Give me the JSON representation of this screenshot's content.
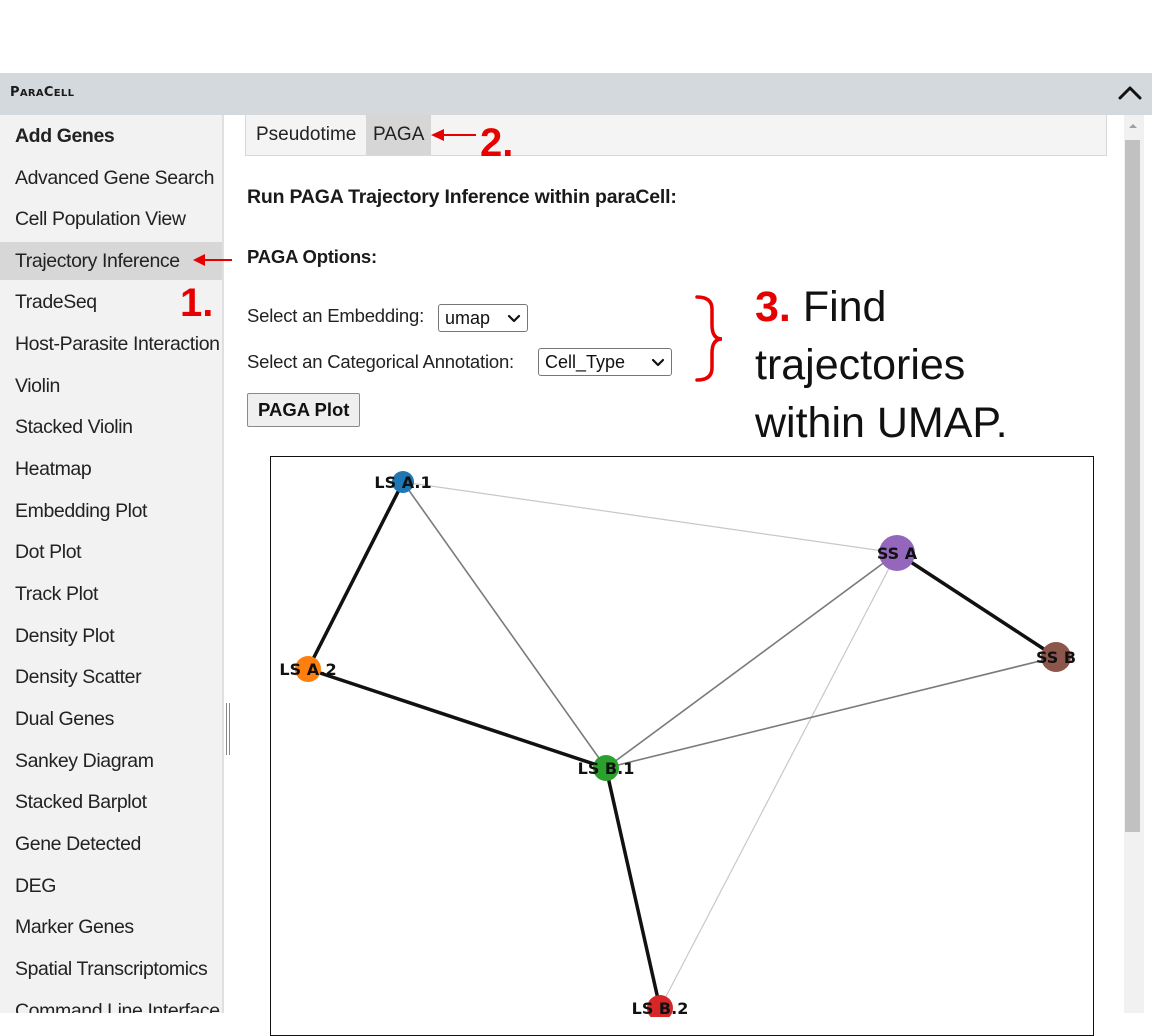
{
  "app": {
    "title_first": "P",
    "title_rest_1": "ARA",
    "title_mid": "C",
    "title_rest_2": "ELL"
  },
  "sidebar": {
    "items": [
      {
        "label": "Add Genes",
        "bold": true
      },
      {
        "label": "Advanced Gene Search"
      },
      {
        "label": "Cell Population View"
      },
      {
        "label": "Trajectory Inference",
        "active": true
      },
      {
        "label": "TradeSeq"
      },
      {
        "label": "Host-Parasite Interaction"
      },
      {
        "label": "Violin"
      },
      {
        "label": "Stacked Violin"
      },
      {
        "label": "Heatmap"
      },
      {
        "label": "Embedding Plot"
      },
      {
        "label": "Dot Plot"
      },
      {
        "label": "Track Plot"
      },
      {
        "label": "Density Plot"
      },
      {
        "label": "Density Scatter"
      },
      {
        "label": "Dual Genes"
      },
      {
        "label": "Sankey Diagram"
      },
      {
        "label": "Stacked Barplot"
      },
      {
        "label": "Gene Detected"
      },
      {
        "label": "DEG"
      },
      {
        "label": "Marker Genes"
      },
      {
        "label": "Spatial Transcriptomics"
      },
      {
        "label": "Command Line Interface"
      }
    ]
  },
  "tabs": [
    {
      "label": "Pseudotime"
    },
    {
      "label": "PAGA",
      "active": true
    }
  ],
  "main": {
    "heading": "Run PAGA Trajectory Inference within paraCell:",
    "options_heading": "PAGA Options:",
    "embedding_label": "Select an Embedding:",
    "embedding_value": "umap",
    "annotation_label": "Select an Categorical Annotation:",
    "annotation_value": "Cell_Type",
    "plot_button": "PAGA Plot"
  },
  "annotations": {
    "step1": "1.",
    "step2": "2.",
    "step3_num": "3.",
    "step3_line1": " Find",
    "step3_line2": "trajectories",
    "step3_line3": "within UMAP.",
    "color": "#e60000"
  },
  "graph": {
    "nodes": [
      {
        "id": "LS A.1",
        "color": "#1f77b4"
      },
      {
        "id": "SS A",
        "color": "#9467bd"
      },
      {
        "id": "SS B",
        "color": "#8c564b"
      },
      {
        "id": "LS A.2",
        "color": "#ff7f0e"
      },
      {
        "id": "LS B.1",
        "color": "#2ca02c"
      },
      {
        "id": "LS B.2",
        "color": "#d62728"
      }
    ],
    "edges": [
      {
        "from": "LS A.1",
        "to": "LS A.2",
        "weight": "strong"
      },
      {
        "from": "LS A.1",
        "to": "SS A",
        "weight": "weak"
      },
      {
        "from": "LS A.1",
        "to": "LS B.1",
        "weight": "medium"
      },
      {
        "from": "SS A",
        "to": "SS B",
        "weight": "strong"
      },
      {
        "from": "SS A",
        "to": "LS B.1",
        "weight": "medium"
      },
      {
        "from": "SS A",
        "to": "LS B.2",
        "weight": "weak"
      },
      {
        "from": "SS B",
        "to": "LS B.1",
        "weight": "medium"
      },
      {
        "from": "LS A.2",
        "to": "LS B.1",
        "weight": "strong"
      },
      {
        "from": "LS B.1",
        "to": "LS B.2",
        "weight": "strong"
      }
    ]
  }
}
